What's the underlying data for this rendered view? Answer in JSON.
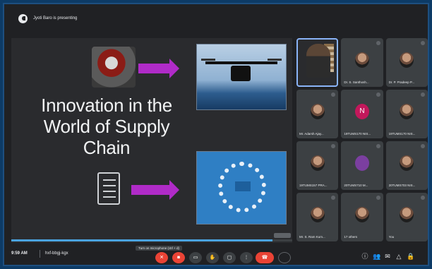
{
  "presenter": {
    "text": "Jyoti Baro is presenting"
  },
  "slide": {
    "title_line1": "Innovation in the",
    "title_line2": "World of Supply Chain",
    "counter": "",
    "progress_fraction": 0.93
  },
  "participants": [
    {
      "name": "",
      "type": "video"
    },
    {
      "name": "Dr. S. Santhosh...",
      "type": "avatar"
    },
    {
      "name": "Dr. P. Pradeep P...",
      "type": "avatar"
    },
    {
      "name": "Mr. Adarsh Ajay...",
      "type": "avatar"
    },
    {
      "name": "19TUMS170 NIS...",
      "type": "letter",
      "letter": "N"
    },
    {
      "name": "19TUMS170 NIS...",
      "type": "avatar"
    },
    {
      "name": "19TUMS157 PRA...",
      "type": "avatar"
    },
    {
      "name": "20TUMS710 M...",
      "type": "letter2",
      "letter": ""
    },
    {
      "name": "20TUMS703 NIS...",
      "type": "avatar"
    },
    {
      "name": "Mr. S. Ram Kum...",
      "type": "avatar"
    },
    {
      "name": "17 others",
      "type": "avatar"
    },
    {
      "name": "You",
      "type": "avatar"
    }
  ],
  "bottombar": {
    "time": "9:59 AM",
    "meeting_code": "hxf-bbgj-kgx",
    "tooltip": "Turn on microphone (ctrl + d)"
  },
  "controls": [
    {
      "name": "microphone-off",
      "icon": "mic-off-icon",
      "state": "red"
    },
    {
      "name": "camera-off",
      "icon": "camera-off-icon",
      "state": "red"
    },
    {
      "name": "captions",
      "icon": "captions-icon",
      "state": "normal"
    },
    {
      "name": "raise-hand",
      "icon": "hand-icon",
      "state": "normal"
    },
    {
      "name": "present",
      "icon": "present-icon",
      "state": "normal"
    },
    {
      "name": "more-options",
      "icon": "more-icon",
      "state": "normal"
    },
    {
      "name": "leave-call",
      "icon": "end-call-icon",
      "state": "end"
    }
  ],
  "colors": {
    "accent": "#8ab4f8",
    "end_call": "#ea4335",
    "arrow": "#b02bc8",
    "progress": "#4aa3df"
  }
}
